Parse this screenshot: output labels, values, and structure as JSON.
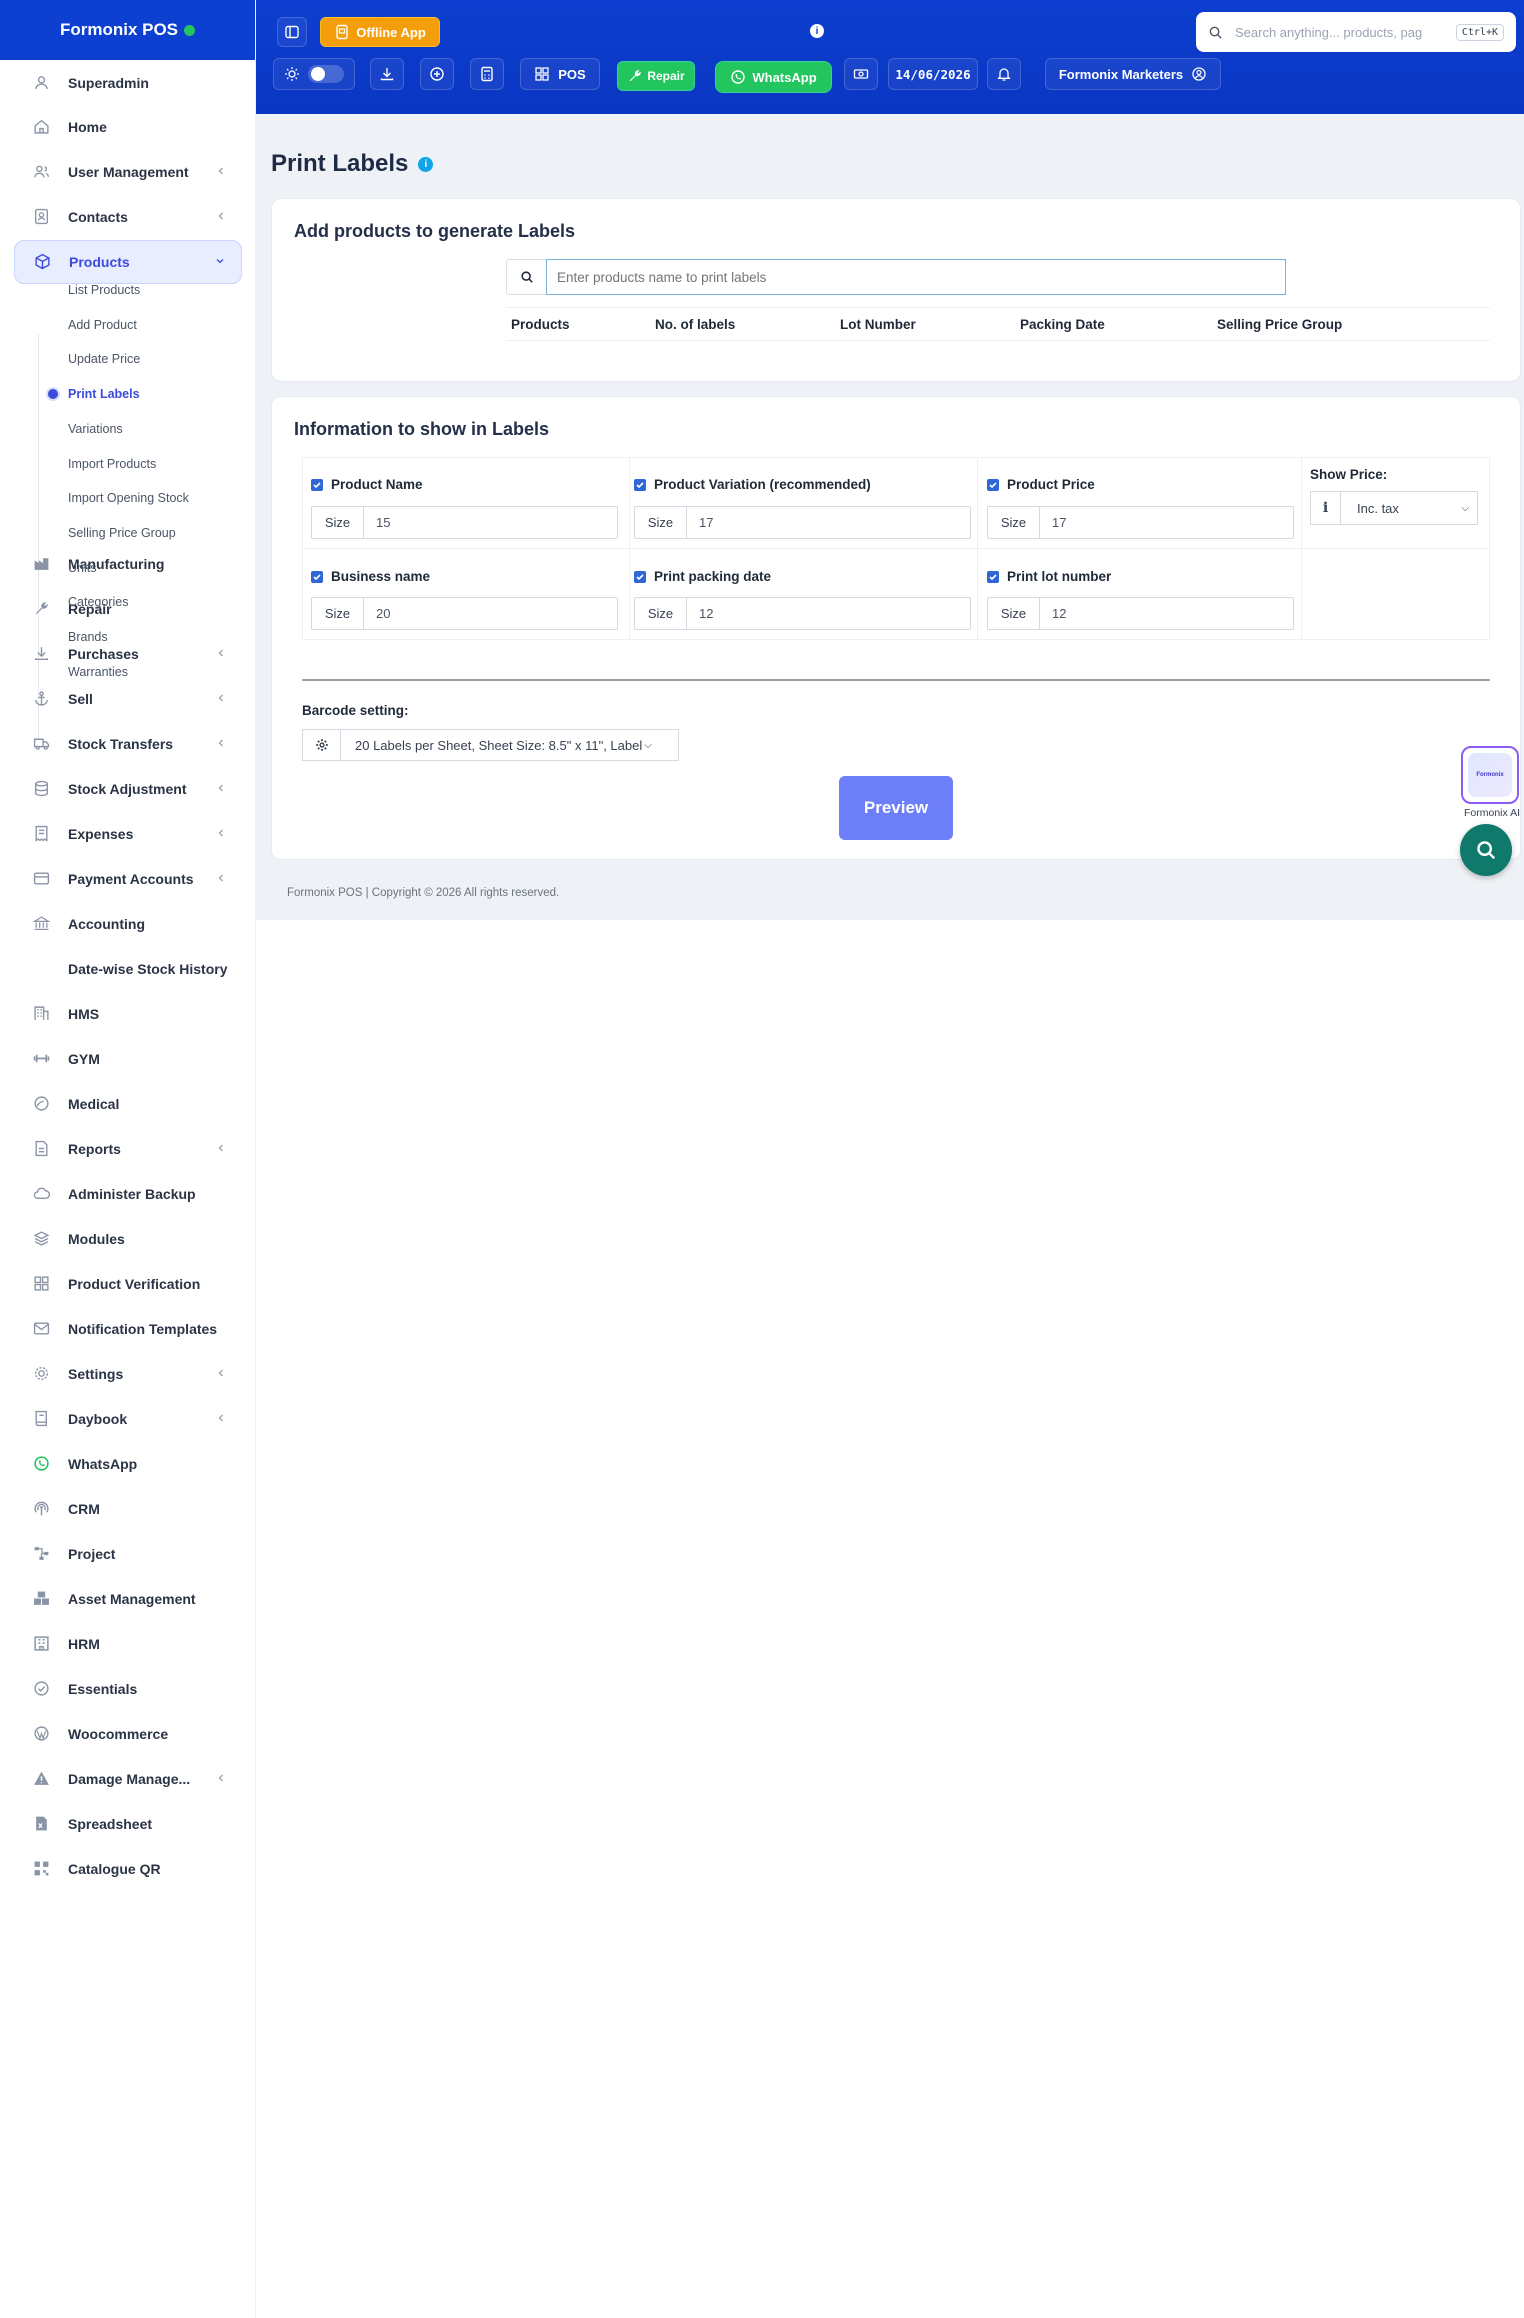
{
  "brand": {
    "name": "Formonix POS"
  },
  "header": {
    "offline_app": "Offline App",
    "pos": "POS",
    "repair": "Repair",
    "whatsapp": "WhatsApp",
    "date": "14/06/2026",
    "business": "Formonix Marketers",
    "search_placeholder": "Search anything... products, pag",
    "shortcut": "Ctrl+K"
  },
  "sidebar": {
    "items": [
      {
        "label": "Superadmin",
        "icon": "superadmin-icon"
      },
      {
        "label": "Home",
        "icon": "home-icon"
      },
      {
        "label": "User Management",
        "icon": "users-icon",
        "chevron": true
      },
      {
        "label": "Contacts",
        "icon": "contacts-icon",
        "chevron": true
      },
      {
        "label": "Products",
        "icon": "box-icon",
        "chevron": true,
        "active": true
      },
      {
        "label": "Manufacturing",
        "icon": "factory-icon"
      },
      {
        "label": "Repair",
        "icon": "wrench-icon"
      },
      {
        "label": "Purchases",
        "icon": "download-icon",
        "chevron": true
      },
      {
        "label": "Sell",
        "icon": "anchor-icon",
        "chevron": true
      },
      {
        "label": "Stock Transfers",
        "icon": "truck-icon",
        "chevron": true
      },
      {
        "label": "Stock Adjustment",
        "icon": "database-icon",
        "chevron": true
      },
      {
        "label": "Expenses",
        "icon": "receipt-icon",
        "chevron": true
      },
      {
        "label": "Payment Accounts",
        "icon": "card-icon",
        "chevron": true
      },
      {
        "label": "Accounting",
        "icon": "bank-icon"
      },
      {
        "label": "Date-wise Stock History",
        "icon": ""
      },
      {
        "label": "HMS",
        "icon": "building-icon"
      },
      {
        "label": "GYM",
        "icon": "dumbbell-icon"
      },
      {
        "label": "Medical",
        "icon": "medical-icon"
      },
      {
        "label": "Reports",
        "icon": "report-icon",
        "chevron": true
      },
      {
        "label": "Administer Backup",
        "icon": "cloud-icon"
      },
      {
        "label": "Modules",
        "icon": "layers-icon"
      },
      {
        "label": "Product Verification",
        "icon": "grid-icon"
      },
      {
        "label": "Notification Templates",
        "icon": "mail-icon"
      },
      {
        "label": "Settings",
        "icon": "gear-icon",
        "chevron": true
      },
      {
        "label": "Daybook",
        "icon": "book-icon",
        "chevron": true
      },
      {
        "label": "WhatsApp",
        "icon": "whatsapp-icon"
      },
      {
        "label": "CRM",
        "icon": "broadcast-icon"
      },
      {
        "label": "Project",
        "icon": "project-icon"
      },
      {
        "label": "Asset Management",
        "icon": "boxes-icon"
      },
      {
        "label": "HRM",
        "icon": "hrm-icon"
      },
      {
        "label": "Essentials",
        "icon": "check-circle-icon"
      },
      {
        "label": "Woocommerce",
        "icon": "wordpress-icon"
      },
      {
        "label": "Damage Manage...",
        "icon": "warning-icon",
        "chevron": true
      },
      {
        "label": "Spreadsheet",
        "icon": "spreadsheet-icon"
      },
      {
        "label": "Catalogue QR",
        "icon": "qr-icon"
      }
    ],
    "subitems": [
      "List Products",
      "Add Product",
      "Update Price",
      "Print Labels",
      "Variations",
      "Import Products",
      "Import Opening Stock",
      "Selling Price Group",
      "Units",
      "Categories",
      "Brands",
      "Warranties"
    ]
  },
  "page": {
    "title": "Print Labels",
    "add_section_title": "Add products to generate Labels",
    "product_search_placeholder": "Enter products name to print labels",
    "table_headers": [
      "Products",
      "No. of labels",
      "Lot Number",
      "Packing Date",
      "Selling Price Group"
    ],
    "info_section_title": "Information to show in Labels",
    "fields": [
      {
        "label": "Product Name",
        "checked": true,
        "size_label": "Size",
        "size": "15"
      },
      {
        "label": "Product Variation (recommended)",
        "checked": true,
        "size_label": "Size",
        "size": "17"
      },
      {
        "label": "Product Price",
        "checked": true,
        "size_label": "Size",
        "size": "17"
      },
      {
        "label": "Business name",
        "checked": true,
        "size_label": "Size",
        "size": "20"
      },
      {
        "label": "Print packing date",
        "checked": true,
        "size_label": "Size",
        "size": "12"
      },
      {
        "label": "Print lot number",
        "checked": true,
        "size_label": "Size",
        "size": "12"
      }
    ],
    "show_price_label": "Show Price:",
    "show_price_value": "Inc. tax",
    "barcode_label": "Barcode setting:",
    "barcode_value": "20 Labels per Sheet, Sheet Size: 8.5\" x 11\", Label",
    "preview": "Preview",
    "footer": "Formonix POS | Copyright © 2026 All rights reserved.",
    "ai_label": "Formonix AI",
    "ai_badge": "Formonix"
  },
  "colors": {
    "header": "#0d3fd0",
    "accent": "#3b4bdc",
    "offline": "#f59e0b",
    "whatsapp": "#22c55e",
    "preview": "#6c7ef8"
  }
}
